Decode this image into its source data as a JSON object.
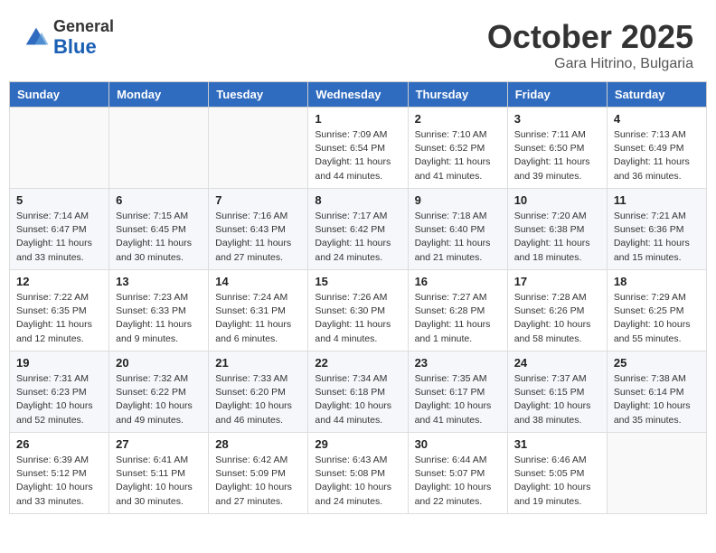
{
  "header": {
    "logo_general": "General",
    "logo_blue": "Blue",
    "month_title": "October 2025",
    "location": "Gara Hitrino, Bulgaria"
  },
  "days_of_week": [
    "Sunday",
    "Monday",
    "Tuesday",
    "Wednesday",
    "Thursday",
    "Friday",
    "Saturday"
  ],
  "weeks": [
    [
      {
        "day": "",
        "info": ""
      },
      {
        "day": "",
        "info": ""
      },
      {
        "day": "",
        "info": ""
      },
      {
        "day": "1",
        "info": "Sunrise: 7:09 AM\nSunset: 6:54 PM\nDaylight: 11 hours\nand 44 minutes."
      },
      {
        "day": "2",
        "info": "Sunrise: 7:10 AM\nSunset: 6:52 PM\nDaylight: 11 hours\nand 41 minutes."
      },
      {
        "day": "3",
        "info": "Sunrise: 7:11 AM\nSunset: 6:50 PM\nDaylight: 11 hours\nand 39 minutes."
      },
      {
        "day": "4",
        "info": "Sunrise: 7:13 AM\nSunset: 6:49 PM\nDaylight: 11 hours\nand 36 minutes."
      }
    ],
    [
      {
        "day": "5",
        "info": "Sunrise: 7:14 AM\nSunset: 6:47 PM\nDaylight: 11 hours\nand 33 minutes."
      },
      {
        "day": "6",
        "info": "Sunrise: 7:15 AM\nSunset: 6:45 PM\nDaylight: 11 hours\nand 30 minutes."
      },
      {
        "day": "7",
        "info": "Sunrise: 7:16 AM\nSunset: 6:43 PM\nDaylight: 11 hours\nand 27 minutes."
      },
      {
        "day": "8",
        "info": "Sunrise: 7:17 AM\nSunset: 6:42 PM\nDaylight: 11 hours\nand 24 minutes."
      },
      {
        "day": "9",
        "info": "Sunrise: 7:18 AM\nSunset: 6:40 PM\nDaylight: 11 hours\nand 21 minutes."
      },
      {
        "day": "10",
        "info": "Sunrise: 7:20 AM\nSunset: 6:38 PM\nDaylight: 11 hours\nand 18 minutes."
      },
      {
        "day": "11",
        "info": "Sunrise: 7:21 AM\nSunset: 6:36 PM\nDaylight: 11 hours\nand 15 minutes."
      }
    ],
    [
      {
        "day": "12",
        "info": "Sunrise: 7:22 AM\nSunset: 6:35 PM\nDaylight: 11 hours\nand 12 minutes."
      },
      {
        "day": "13",
        "info": "Sunrise: 7:23 AM\nSunset: 6:33 PM\nDaylight: 11 hours\nand 9 minutes."
      },
      {
        "day": "14",
        "info": "Sunrise: 7:24 AM\nSunset: 6:31 PM\nDaylight: 11 hours\nand 6 minutes."
      },
      {
        "day": "15",
        "info": "Sunrise: 7:26 AM\nSunset: 6:30 PM\nDaylight: 11 hours\nand 4 minutes."
      },
      {
        "day": "16",
        "info": "Sunrise: 7:27 AM\nSunset: 6:28 PM\nDaylight: 11 hours\nand 1 minute."
      },
      {
        "day": "17",
        "info": "Sunrise: 7:28 AM\nSunset: 6:26 PM\nDaylight: 10 hours\nand 58 minutes."
      },
      {
        "day": "18",
        "info": "Sunrise: 7:29 AM\nSunset: 6:25 PM\nDaylight: 10 hours\nand 55 minutes."
      }
    ],
    [
      {
        "day": "19",
        "info": "Sunrise: 7:31 AM\nSunset: 6:23 PM\nDaylight: 10 hours\nand 52 minutes."
      },
      {
        "day": "20",
        "info": "Sunrise: 7:32 AM\nSunset: 6:22 PM\nDaylight: 10 hours\nand 49 minutes."
      },
      {
        "day": "21",
        "info": "Sunrise: 7:33 AM\nSunset: 6:20 PM\nDaylight: 10 hours\nand 46 minutes."
      },
      {
        "day": "22",
        "info": "Sunrise: 7:34 AM\nSunset: 6:18 PM\nDaylight: 10 hours\nand 44 minutes."
      },
      {
        "day": "23",
        "info": "Sunrise: 7:35 AM\nSunset: 6:17 PM\nDaylight: 10 hours\nand 41 minutes."
      },
      {
        "day": "24",
        "info": "Sunrise: 7:37 AM\nSunset: 6:15 PM\nDaylight: 10 hours\nand 38 minutes."
      },
      {
        "day": "25",
        "info": "Sunrise: 7:38 AM\nSunset: 6:14 PM\nDaylight: 10 hours\nand 35 minutes."
      }
    ],
    [
      {
        "day": "26",
        "info": "Sunrise: 6:39 AM\nSunset: 5:12 PM\nDaylight: 10 hours\nand 33 minutes."
      },
      {
        "day": "27",
        "info": "Sunrise: 6:41 AM\nSunset: 5:11 PM\nDaylight: 10 hours\nand 30 minutes."
      },
      {
        "day": "28",
        "info": "Sunrise: 6:42 AM\nSunset: 5:09 PM\nDaylight: 10 hours\nand 27 minutes."
      },
      {
        "day": "29",
        "info": "Sunrise: 6:43 AM\nSunset: 5:08 PM\nDaylight: 10 hours\nand 24 minutes."
      },
      {
        "day": "30",
        "info": "Sunrise: 6:44 AM\nSunset: 5:07 PM\nDaylight: 10 hours\nand 22 minutes."
      },
      {
        "day": "31",
        "info": "Sunrise: 6:46 AM\nSunset: 5:05 PM\nDaylight: 10 hours\nand 19 minutes."
      },
      {
        "day": "",
        "info": ""
      }
    ]
  ]
}
